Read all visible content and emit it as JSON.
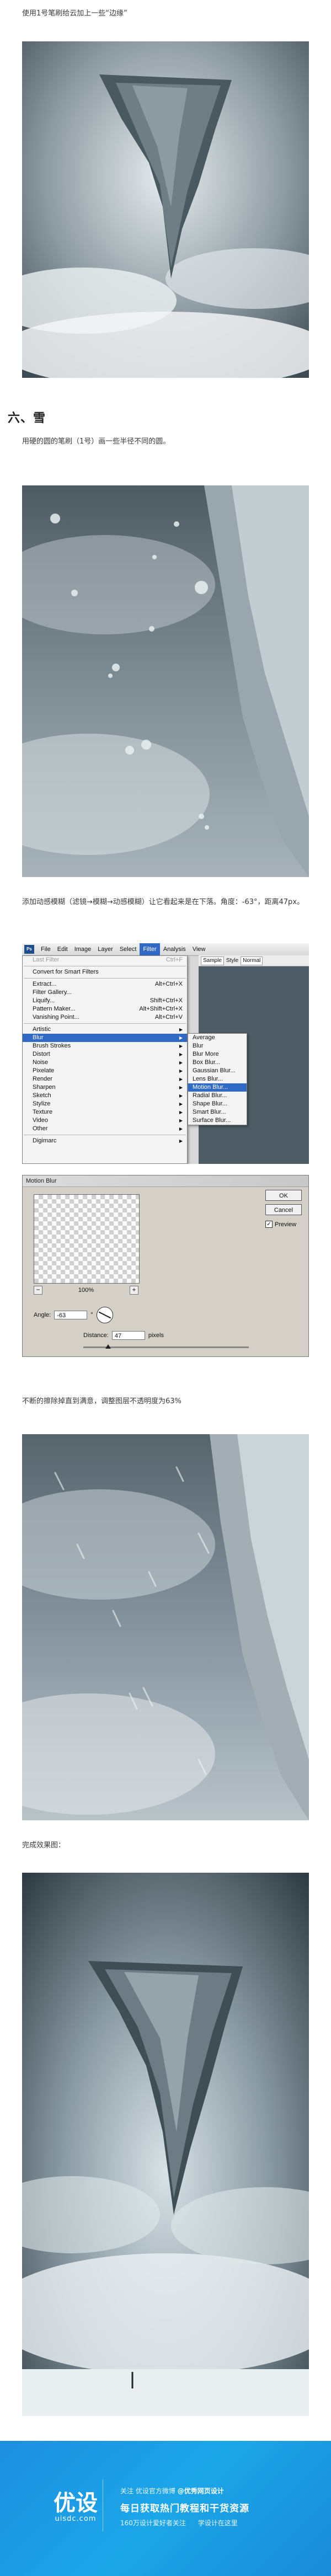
{
  "captions": {
    "c1": "使用1号笔刷给云加上一些“边缘”",
    "heading": "六、雪",
    "c2": "用硬的圆的笔刷（1号）画一些半径不同的圆。",
    "c3": "添加动感模糊（滤镜→模糊→动感模糊）让它看起来是在下落。角度：-63°，距离47px。",
    "c4": "不断的擦除掉直到满意，调整图层不透明度为63%",
    "c5": "完成效果图："
  },
  "ps_menubar": [
    "File",
    "Edit",
    "Image",
    "Layer",
    "Select",
    "Filter",
    "Analysis",
    "View"
  ],
  "ps_toolbar": [
    "Sample",
    "Style",
    "Normal"
  ],
  "ps_menu": {
    "last_filter": {
      "label": "Last Filter",
      "shortcut": "Ctrl+F"
    },
    "convert": "Convert for Smart Filters",
    "group1": [
      {
        "label": "Extract...",
        "shortcut": "Alt+Ctrl+X"
      },
      {
        "label": "Filter Gallery...",
        "shortcut": ""
      },
      {
        "label": "Liquify...",
        "shortcut": "Shift+Ctrl+X"
      },
      {
        "label": "Pattern Maker...",
        "shortcut": "Alt+Shift+Ctrl+X"
      },
      {
        "label": "Vanishing Point...",
        "shortcut": "Alt+Ctrl+V"
      }
    ],
    "group2": [
      "Artistic",
      "Blur",
      "Brush Strokes",
      "Distort",
      "Noise",
      "Pixelate",
      "Render",
      "Sharpen",
      "Sketch",
      "Stylize",
      "Texture",
      "Video",
      "Other"
    ],
    "group3": [
      "Digimarc"
    ]
  },
  "ps_blur_submenu": [
    "Average",
    "Blur",
    "Blur More",
    "Box Blur...",
    "Gaussian Blur...",
    "Lens Blur...",
    "Motion Blur...",
    "Radial Blur...",
    "Shape Blur...",
    "Smart Blur...",
    "Surface Blur..."
  ],
  "motion_blur": {
    "title": "Motion Blur",
    "ok": "OK",
    "cancel": "Cancel",
    "preview": "Preview",
    "zoom": "100%",
    "angle_label": "Angle:",
    "angle_value": "-63",
    "angle_unit": "°",
    "distance_label": "Distance:",
    "distance_value": "47",
    "distance_unit": "pixels"
  },
  "footer": {
    "logo_main": "优设",
    "logo_sub": "uisdc.com",
    "line1_prefix": "关注",
    "line1_mid": "优设官方微博",
    "line1_handle": "@优秀网页设计",
    "line2": "每日获取热门教程和干货资源",
    "line3_a": "160万设计爱好者关注",
    "line3_b": "学设计在这里"
  },
  "colors": {
    "footer_bg": "#1a9be3",
    "menu_highlight": "#316ac5"
  }
}
